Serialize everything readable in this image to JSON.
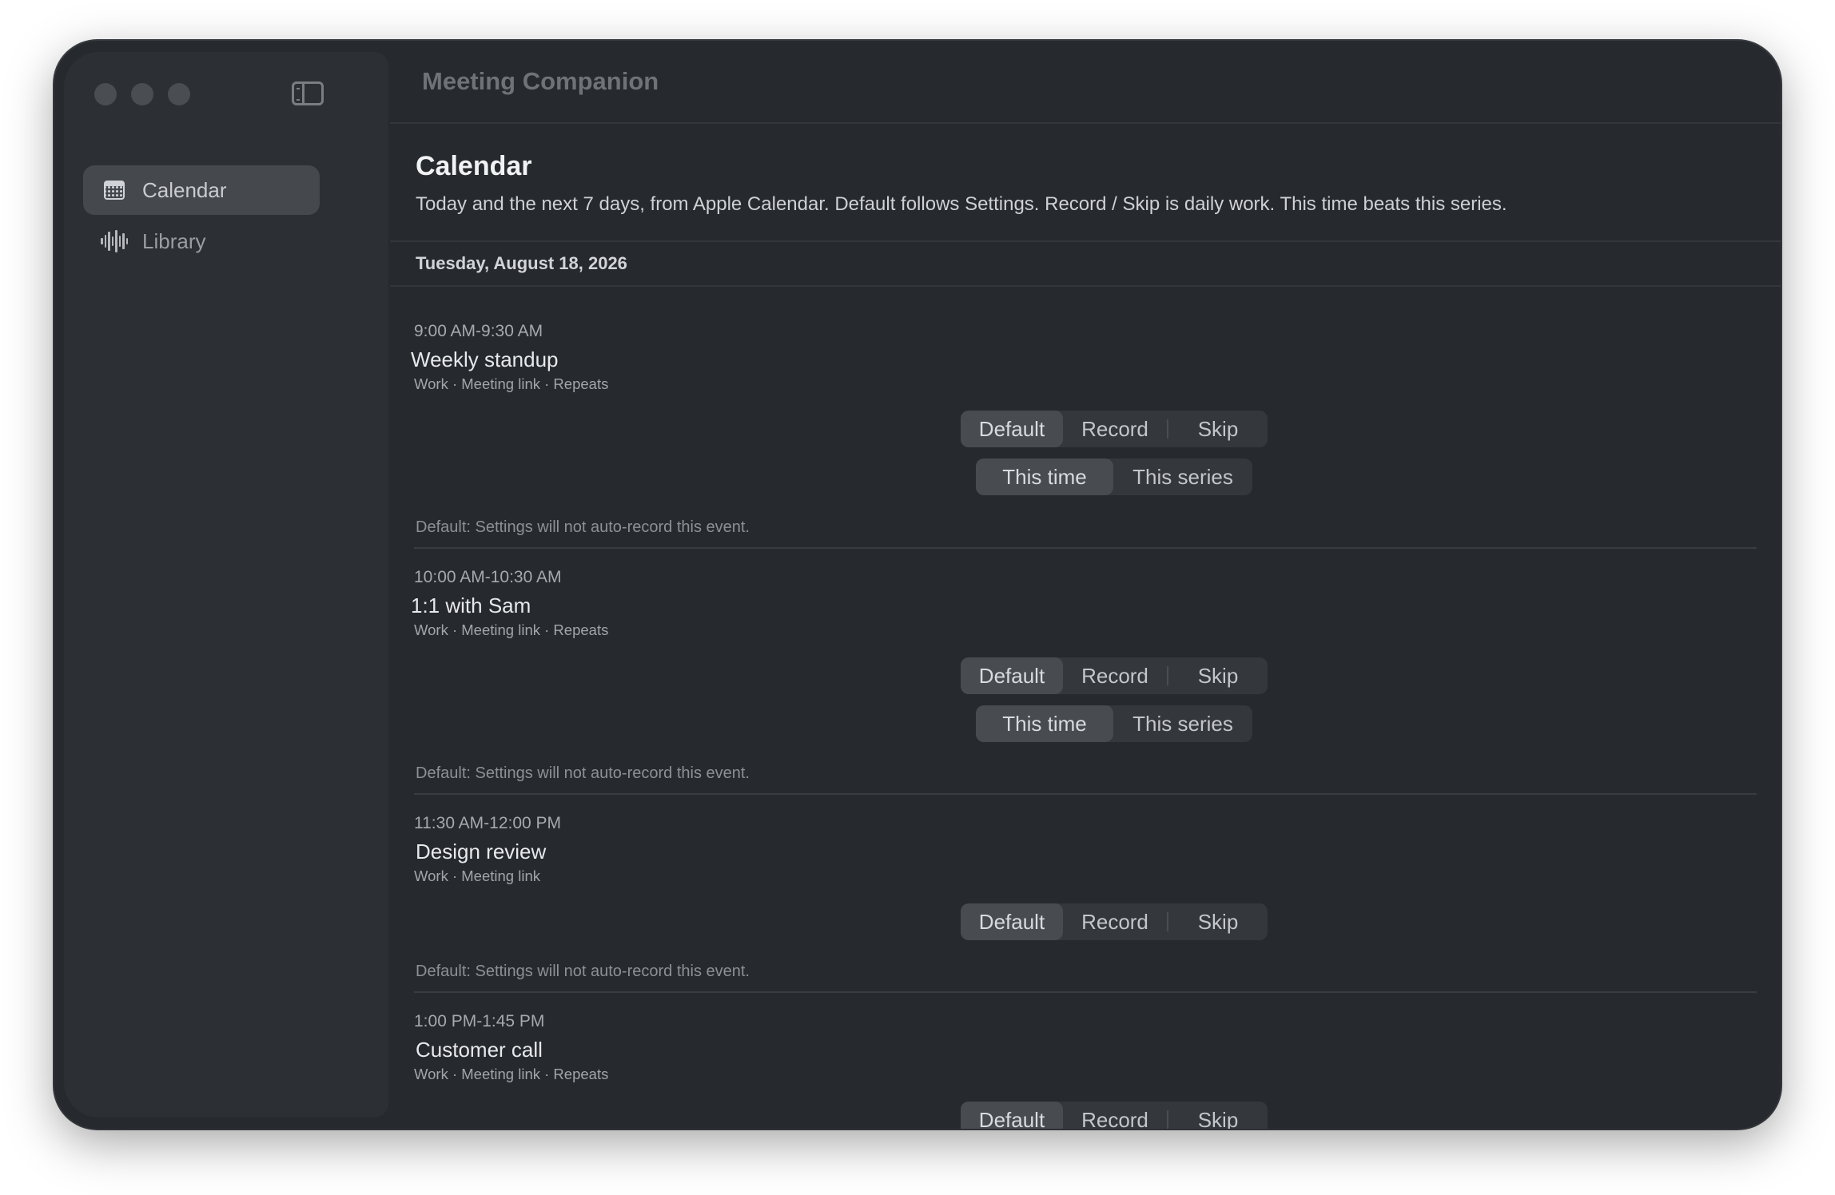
{
  "app": {
    "title": "Meeting Companion"
  },
  "sidebar": {
    "items": [
      {
        "label": "Calendar",
        "icon": "calendar-icon",
        "selected": true
      },
      {
        "label": "Library",
        "icon": "waveform-icon",
        "selected": false
      }
    ]
  },
  "page": {
    "title": "Calendar",
    "subtitle": "Today and the next 7 days, from Apple Calendar. Default follows Settings. Record / Skip is daily work. This time beats this series."
  },
  "day": {
    "label": "Tuesday, August 18, 2026"
  },
  "controls": {
    "default": "Default",
    "record": "Record",
    "skip": "Skip",
    "this_time": "This time",
    "this_series": "This series"
  },
  "events": [
    {
      "time": "9:00 AM-9:30 AM",
      "title": "Weekly standup",
      "meta": "Work · Meeting link · Repeats",
      "note": "Default: Settings will not auto-record this event.",
      "selected": "Default",
      "scope": "This time"
    },
    {
      "time": "10:00 AM-10:30 AM",
      "title": "1:1 with Sam",
      "meta": "Work · Meeting link · Repeats",
      "note": "Default: Settings will not auto-record this event.",
      "selected": "Default",
      "scope": "This time"
    },
    {
      "time": "11:30 AM-12:00 PM",
      "title": "Design review",
      "meta": "Work · Meeting link",
      "note": "Default: Settings will not auto-record this event.",
      "selected": "Default"
    },
    {
      "time": "1:00 PM-1:45 PM",
      "title": "Customer call",
      "meta": "Work · Meeting link · Repeats",
      "selected": "Default"
    }
  ]
}
